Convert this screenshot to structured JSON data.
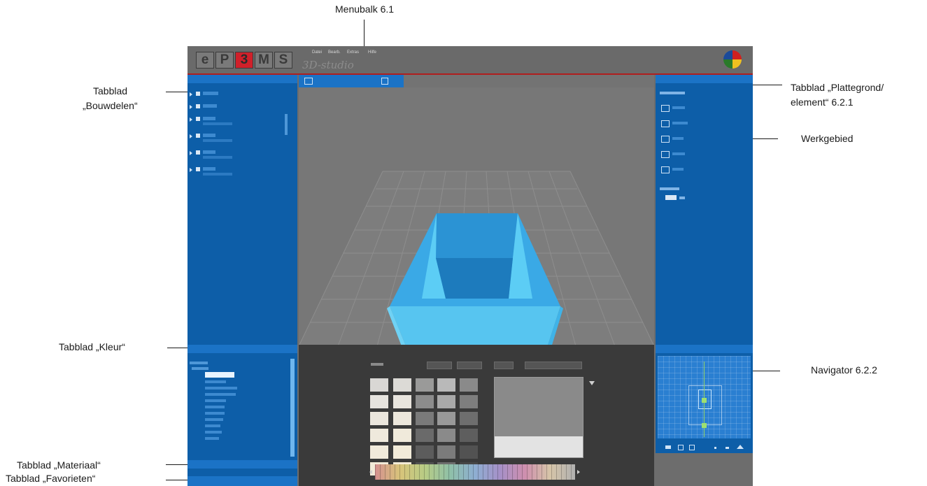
{
  "callouts": {
    "menubalk": "Menubalk 6.1",
    "bouwdelen_1": "Tabblad",
    "bouwdelen_2": "„Bouwdelen“",
    "plattegrond_1": "Tabblad „Plattegrond/",
    "plattegrond_2": "element“ 6.2.1",
    "werkgebied": "Werkgebied",
    "kleur": "Tabblad „Kleur“",
    "navigator": "Navigator 6.2.2",
    "materiaal": "Tabblad „Materiaal“",
    "favorieten": "Tabblad „Favorieten“"
  },
  "app": {
    "logo": [
      "e",
      "P",
      "3",
      "M",
      "S"
    ],
    "menu": [
      "Datei",
      "Bearb.",
      "Extras",
      "Hilfe"
    ],
    "subtitle": "3D-studio"
  },
  "colors": {
    "panel_blue": "#0d5ea8",
    "header_blue": "#1b73c6",
    "box_cyan": "#4fc4f2",
    "accent_red": "#b01e1e"
  },
  "icons": [
    "fold-arrow-icon",
    "visibility-icon",
    "floorplan-type-icon",
    "filter-icon",
    "camera-icon",
    "navigator-view-icon"
  ]
}
